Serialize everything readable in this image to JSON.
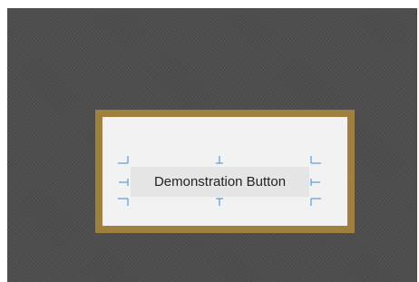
{
  "demo_button": {
    "label": "Demonstration Button"
  },
  "colors": {
    "canvas_background": "#4d4d4d",
    "frame_border": "#a07f3f",
    "frame_fill": "#f2f2f2",
    "button_fill": "#e5e5e5",
    "alignment_markers": "#3c8be0"
  },
  "icons": {
    "alignment_markers": [
      "top-left-alignment-icon",
      "top-center-alignment-icon",
      "top-right-alignment-icon",
      "middle-left-alignment-icon",
      "middle-right-alignment-icon",
      "bottom-left-alignment-icon",
      "bottom-center-alignment-icon",
      "bottom-right-alignment-icon"
    ]
  }
}
